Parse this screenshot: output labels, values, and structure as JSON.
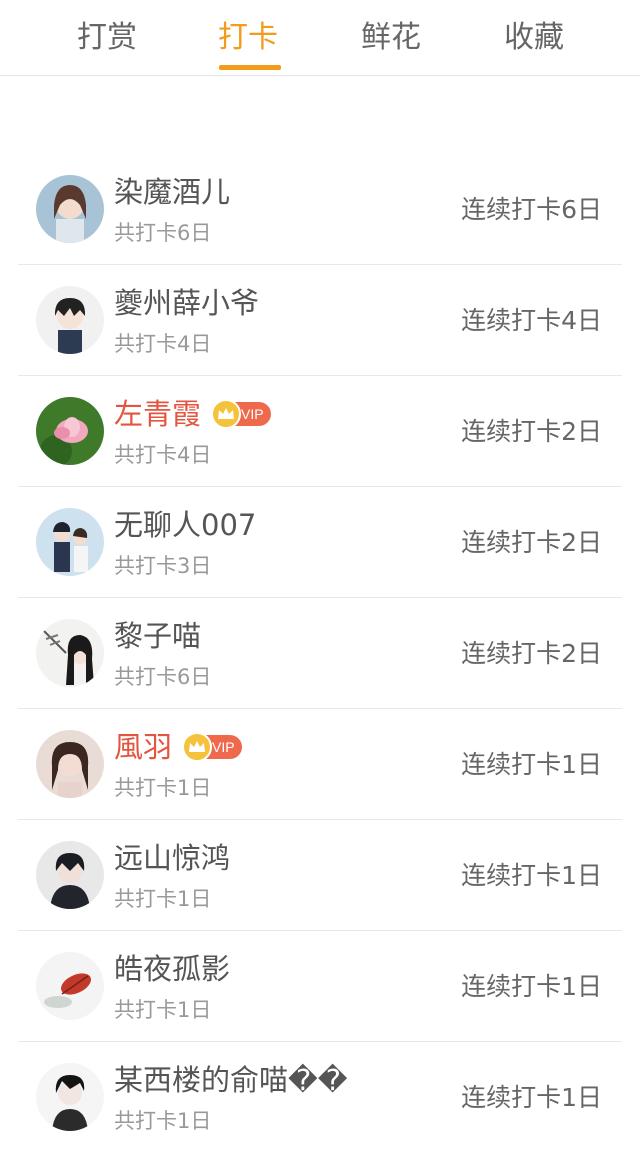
{
  "tabs": [
    {
      "label": "打赏",
      "active": false
    },
    {
      "label": "打卡",
      "active": true
    },
    {
      "label": "鲜花",
      "active": false
    },
    {
      "label": "收藏",
      "active": false
    }
  ],
  "colors": {
    "accent": "#f29b1c",
    "vip_name": "#e4553f",
    "vip_badge": "#ef6a4c",
    "crown": "#f5c23b"
  },
  "vip_badge_text": "VIP",
  "users": [
    {
      "name": "染魔酒儿",
      "vip": false,
      "total": "共打卡6日",
      "streak": "连续打卡6日",
      "avatar_icon": "anime-girl-avatar"
    },
    {
      "name": "夔州薛小爷",
      "vip": false,
      "total": "共打卡4日",
      "streak": "连续打卡4日",
      "avatar_icon": "anime-boy-avatar"
    },
    {
      "name": "左青霞",
      "vip": true,
      "total": "共打卡4日",
      "streak": "连续打卡2日",
      "avatar_icon": "lotus-flower-avatar"
    },
    {
      "name": "无聊人007",
      "vip": false,
      "total": "共打卡3日",
      "streak": "连续打卡2日",
      "avatar_icon": "couple-avatar"
    },
    {
      "name": "黎子喵",
      "vip": false,
      "total": "共打卡6日",
      "streak": "连续打卡2日",
      "avatar_icon": "ink-girl-avatar"
    },
    {
      "name": "風羽",
      "vip": true,
      "total": "共打卡1日",
      "streak": "连续打卡1日",
      "avatar_icon": "girl-photo-avatar"
    },
    {
      "name": "远山惊鸿",
      "vip": false,
      "total": "共打卡1日",
      "streak": "连续打卡1日",
      "avatar_icon": "dark-boy-avatar"
    },
    {
      "name": "皓夜孤影",
      "vip": false,
      "total": "共打卡1日",
      "streak": "连续打卡1日",
      "avatar_icon": "red-leaf-avatar"
    },
    {
      "name": "某西楼的俞喵��",
      "vip": false,
      "total": "共打卡1日",
      "streak": "连续打卡1日",
      "avatar_icon": "sketch-boy-avatar"
    }
  ]
}
